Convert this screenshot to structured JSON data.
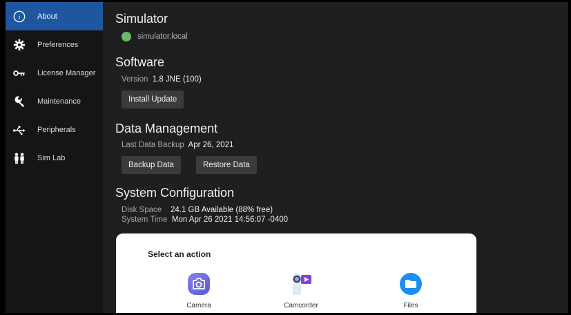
{
  "sidebar": {
    "items": [
      {
        "label": "About",
        "icon": "info-icon"
      },
      {
        "label": "Preferences",
        "icon": "gear-icon"
      },
      {
        "label": "License Manager",
        "icon": "key-icon"
      },
      {
        "label": "Maintenance",
        "icon": "wrench-icon"
      },
      {
        "label": "Peripherals",
        "icon": "usb-icon"
      },
      {
        "label": "Sim Lab",
        "icon": "people-icon"
      }
    ]
  },
  "simulator": {
    "heading": "Simulator",
    "host": "simulator.local",
    "status_color": "#72b86c"
  },
  "software": {
    "heading": "Software",
    "version_label": "Version",
    "version_value": "1.8 JNE (100)",
    "install_button": "Install Update"
  },
  "data_management": {
    "heading": "Data Management",
    "backup_label": "Last Data Backup",
    "backup_value": "Apr 26, 2021",
    "backup_button": "Backup Data",
    "restore_button": "Restore Data"
  },
  "system_config": {
    "heading": "System Configuration",
    "disk_label": "Disk Space",
    "disk_value": "24.1 GB Available (88% free)",
    "time_label": "System Time",
    "time_value": "Mon Apr 26 2021 14:56:07 -0400"
  },
  "action_sheet": {
    "title": "Select an action",
    "apps": [
      {
        "label": "Camera",
        "icon": "camera-icon"
      },
      {
        "label": "Camcorder",
        "icon": "camcorder-icon"
      },
      {
        "label": "Files",
        "icon": "folder-icon"
      }
    ]
  },
  "colors": {
    "accent": "#1e56a0",
    "panel": "#1e1f1f",
    "sidebar": "#151515"
  }
}
